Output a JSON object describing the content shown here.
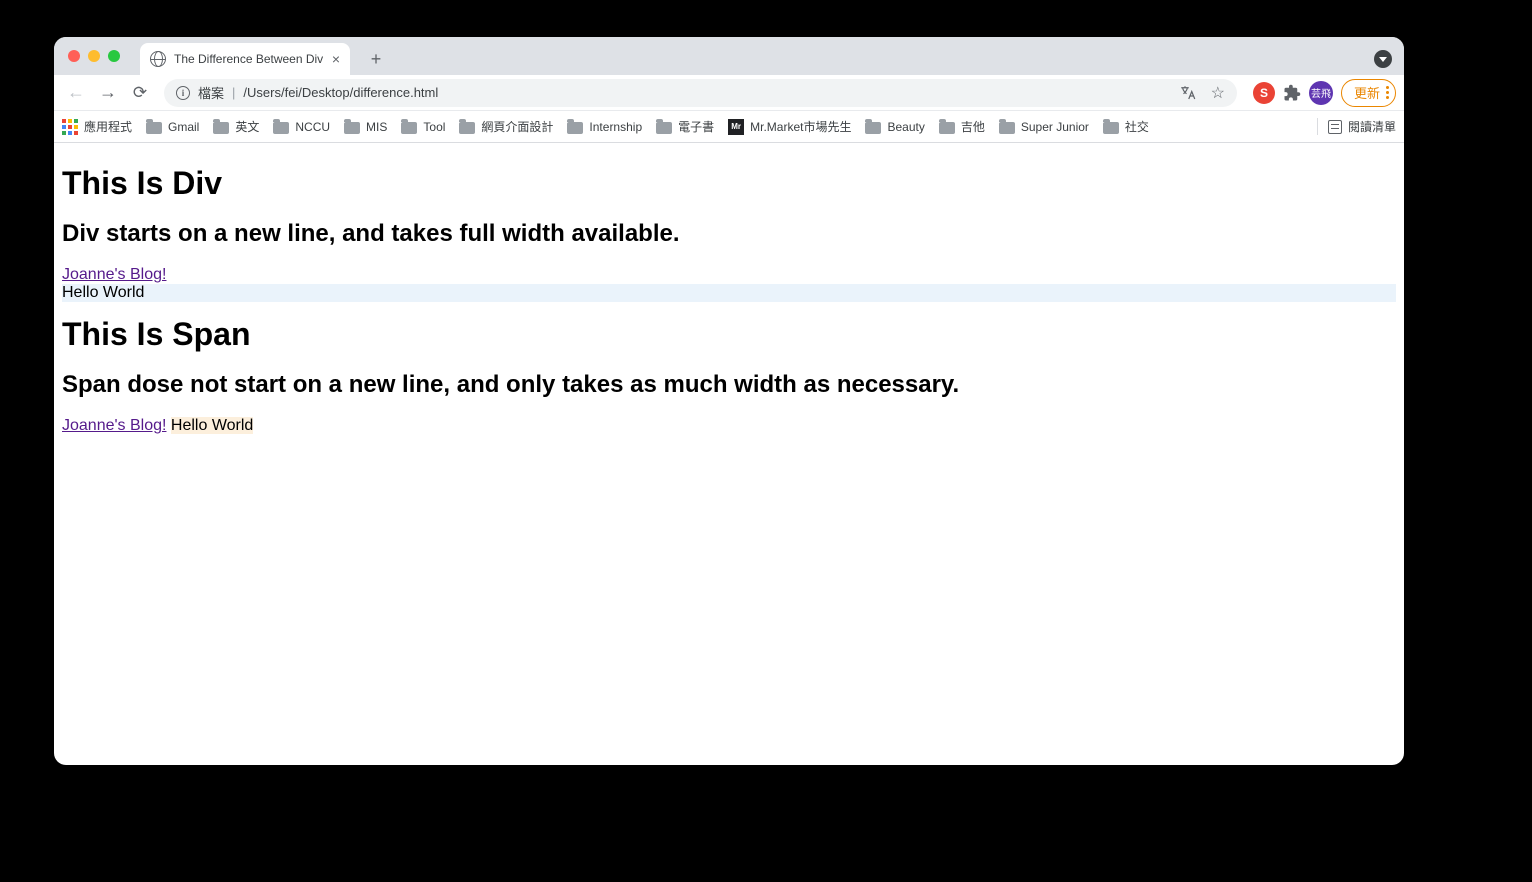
{
  "tab": {
    "title": "The Difference Between Div an"
  },
  "address": {
    "scheme_label": "檔案",
    "path": "/Users/fei/Desktop/difference.html"
  },
  "profile": {
    "avatar_text": "芸飛",
    "update_label": "更新",
    "ext_s": "S",
    "mr_label": "Mr"
  },
  "bookmarks": {
    "apps_label": "應用程式",
    "items": [
      {
        "label": "Gmail",
        "kind": "folder"
      },
      {
        "label": "英文",
        "kind": "folder"
      },
      {
        "label": "NCCU",
        "kind": "folder"
      },
      {
        "label": "MIS",
        "kind": "folder"
      },
      {
        "label": "Tool",
        "kind": "folder"
      },
      {
        "label": "網頁介面設計",
        "kind": "folder"
      },
      {
        "label": "Internship",
        "kind": "folder"
      },
      {
        "label": "電子書",
        "kind": "folder"
      },
      {
        "label": "Mr.Market市場先生",
        "kind": "mr"
      },
      {
        "label": "Beauty",
        "kind": "folder"
      },
      {
        "label": "吉他",
        "kind": "folder"
      },
      {
        "label": "Super Junior",
        "kind": "folder"
      },
      {
        "label": "社交",
        "kind": "folder"
      }
    ],
    "reading_list_label": "閱讀清單"
  },
  "page": {
    "h1_div": "This Is Div",
    "h2_div": "Div starts on a new line, and takes full width available.",
    "link_div": "Joanne's Blog!",
    "hello_div": "Hello World",
    "h1_span": "This Is Span",
    "h2_span": "Span dose not start on a new line, and only takes as much width as necessary.",
    "link_span": "Joanne's Blog!",
    "hello_span": "Hello World"
  }
}
